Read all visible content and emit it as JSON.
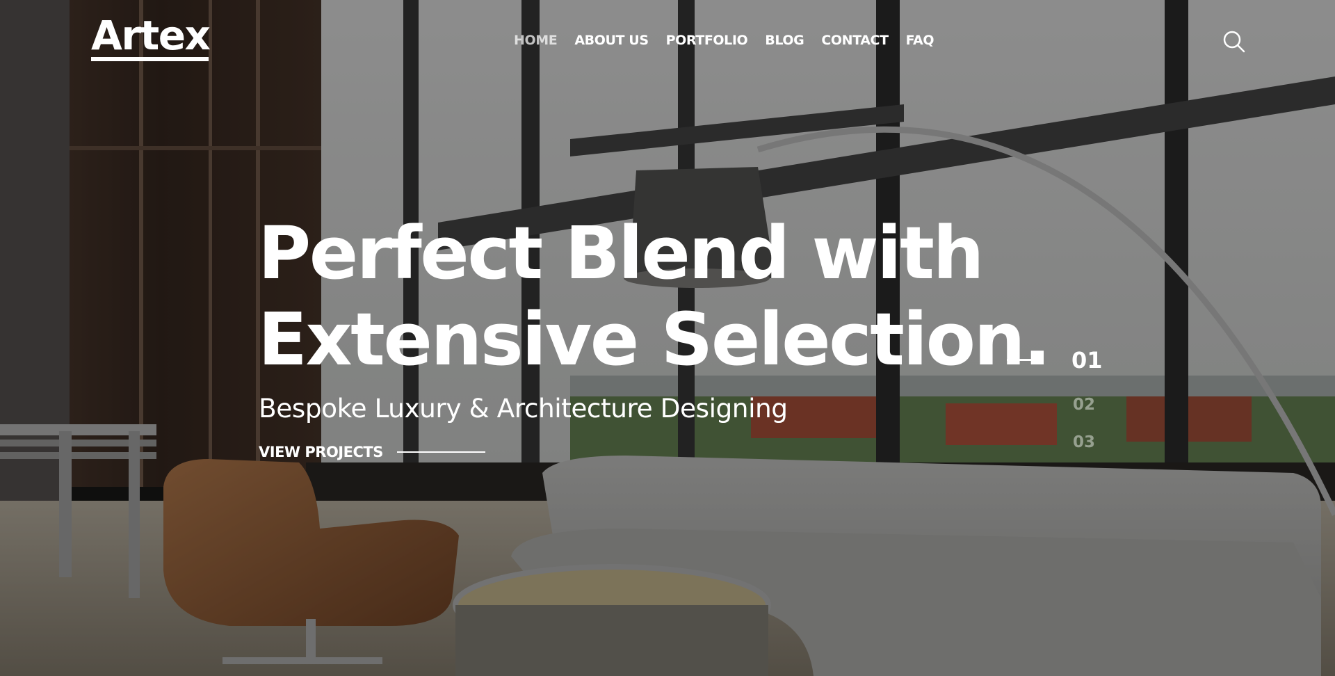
{
  "brand": {
    "name": "Artex"
  },
  "nav": {
    "items": [
      {
        "label": "HOME",
        "active": true
      },
      {
        "label": "ABOUT US"
      },
      {
        "label": "PORTFOLIO"
      },
      {
        "label": "BLOG"
      },
      {
        "label": "CONTACT"
      },
      {
        "label": "FAQ"
      }
    ],
    "search_icon": "search-icon"
  },
  "hero": {
    "title_line1": "Perfect Blend with",
    "title_line2": "Extensive Selection.",
    "subtitle": "Bespoke Luxury & Architecture Designing",
    "cta_label": "VIEW PROJECTS"
  },
  "slider": {
    "items": [
      "01",
      "02",
      "03"
    ],
    "active": "01"
  },
  "colors": {
    "text": "#ffffff",
    "overlay": "#000000",
    "chair": "#8a5a38",
    "sofa": "#8b8b89",
    "window": "#d8dad9"
  }
}
